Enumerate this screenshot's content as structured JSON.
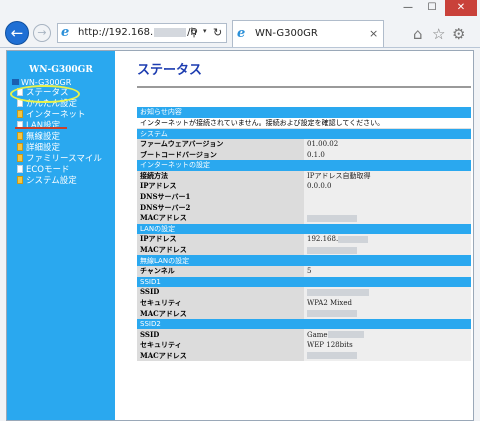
{
  "window": {
    "min": "—",
    "max": "☐",
    "close": "✕"
  },
  "browser": {
    "back": "←",
    "forward": "→",
    "address_prefix": "http://192.168.",
    "address_suffix": "/h",
    "search_glyph": "⚲",
    "dropdown": "▾",
    "refresh": "↻",
    "ie_glyph": "e",
    "tab_title": "WN-G300GR",
    "tab_close": "×",
    "home": "⌂",
    "favorites": "☆",
    "tools": "⚙"
  },
  "sidebar": {
    "brand": "WN-G300GR",
    "root_label": "WN-G300GR",
    "items": [
      {
        "label": "ステータス",
        "icon": "doc-icon"
      },
      {
        "label": "かんたん設定",
        "icon": "doc-icon"
      },
      {
        "label": "インターネット",
        "icon": "folder-icon"
      },
      {
        "label": "LAN設定",
        "icon": "doc-icon"
      },
      {
        "label": "無線設定",
        "icon": "folder-icon"
      },
      {
        "label": "詳細設定",
        "icon": "folder-icon"
      },
      {
        "label": "ファミリースマイル",
        "icon": "folder-icon"
      },
      {
        "label": "ECOモード",
        "icon": "doc-icon"
      },
      {
        "label": "システム設定",
        "icon": "folder-icon"
      }
    ]
  },
  "main": {
    "title": "ステータス",
    "rows": [
      {
        "type": "section",
        "label": "お知らせ内容"
      },
      {
        "type": "notice",
        "text": "インターネットが接続されていません。接続および設定を確認してください。"
      },
      {
        "type": "section",
        "label": "システム"
      },
      {
        "type": "row",
        "key": "ファームウェアバージョン",
        "value": "01.00.02"
      },
      {
        "type": "row",
        "key": "ブートコードバージョン",
        "value": "0.1.0"
      },
      {
        "type": "section",
        "label": "インターネットの設定"
      },
      {
        "type": "row",
        "key": "接続方法",
        "value": "IPアドレス自動取得"
      },
      {
        "type": "row",
        "key": "IPアドレス",
        "value": "0.0.0.0"
      },
      {
        "type": "row",
        "key": "DNSサーバー1",
        "value": ""
      },
      {
        "type": "row",
        "key": "DNSサーバー2",
        "value": ""
      },
      {
        "type": "row",
        "key": "MACアドレス",
        "value": "",
        "masked": "w1"
      },
      {
        "type": "section",
        "label": "LANの設定"
      },
      {
        "type": "row",
        "key": "IPアドレス",
        "value": "192.168.",
        "masked": "w4"
      },
      {
        "type": "row",
        "key": "MACアドレス",
        "value": "",
        "masked": "w1"
      },
      {
        "type": "section",
        "label": "無線LANの設定"
      },
      {
        "type": "row",
        "key": "チャンネル",
        "value": "5"
      },
      {
        "type": "section",
        "label": "SSID1"
      },
      {
        "type": "row",
        "key": "SSID",
        "value": "",
        "masked": "w3"
      },
      {
        "type": "row",
        "key": "セキュリティ",
        "value": "WPA2 Mixed"
      },
      {
        "type": "row",
        "key": "MACアドレス",
        "value": "",
        "masked": "w1"
      },
      {
        "type": "section",
        "label": "SSID2"
      },
      {
        "type": "row",
        "key": "SSID",
        "value": "Game",
        "masked": "w2"
      },
      {
        "type": "row",
        "key": "セキュリティ",
        "value": "WEP 128bits"
      },
      {
        "type": "row",
        "key": "MACアドレス",
        "value": "",
        "masked": "w1"
      }
    ]
  }
}
